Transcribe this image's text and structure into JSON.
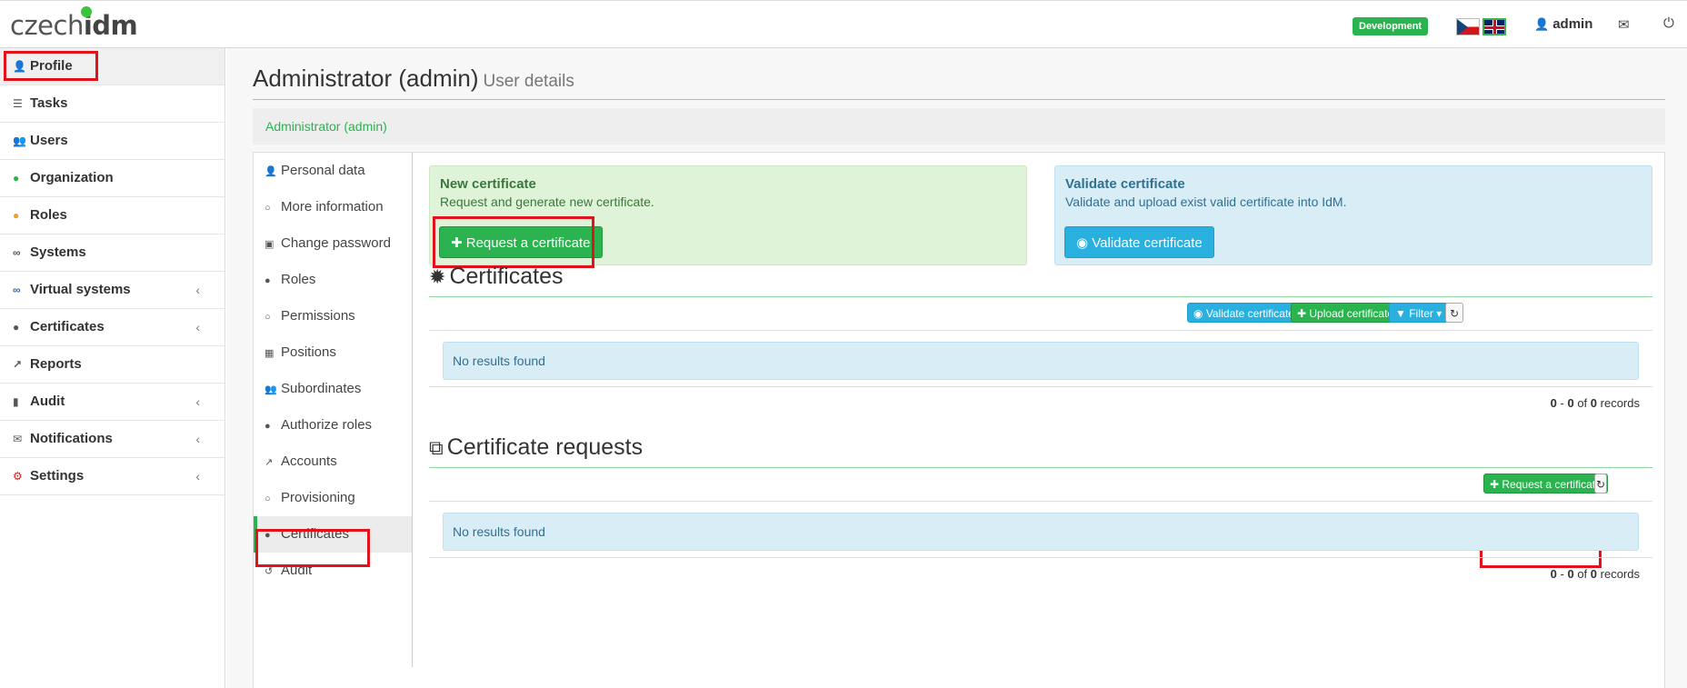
{
  "app": {
    "logo": {
      "prefix": "czech",
      "suffix": "idm"
    },
    "environment_badge": "Development",
    "user": "admin",
    "languages": [
      "cs",
      "en"
    ]
  },
  "sidebar": {
    "items": [
      {
        "label": "Profile",
        "icon": "user-icon",
        "active": true,
        "has_submenu": false
      },
      {
        "label": "Tasks",
        "icon": "tasks-icon",
        "has_submenu": false
      },
      {
        "label": "Users",
        "icon": "users-icon",
        "has_submenu": false
      },
      {
        "label": "Organization",
        "icon": "tree-icon",
        "has_submenu": false
      },
      {
        "label": "Roles",
        "icon": "role-icon",
        "has_submenu": false
      },
      {
        "label": "Systems",
        "icon": "link-icon",
        "has_submenu": false
      },
      {
        "label": "Virtual systems",
        "icon": "link-icon",
        "has_submenu": true
      },
      {
        "label": "Certificates",
        "icon": "circle-icon",
        "has_submenu": true
      },
      {
        "label": "Reports",
        "icon": "chart-icon",
        "has_submenu": false
      },
      {
        "label": "Audit",
        "icon": "bar-chart-icon",
        "has_submenu": true
      },
      {
        "label": "Notifications",
        "icon": "envelope-icon",
        "has_submenu": true
      },
      {
        "label": "Settings",
        "icon": "cog-icon",
        "has_submenu": true
      }
    ],
    "chevron": "‹"
  },
  "page": {
    "title": "Administrator (admin)",
    "subtitle": "User details",
    "breadcrumb": "Administrator (admin)"
  },
  "subnav": {
    "items": [
      {
        "label": "Personal data",
        "icon": "user-icon"
      },
      {
        "label": "More information",
        "icon": "circle-outline-icon"
      },
      {
        "label": "Change password",
        "icon": "lock-icon"
      },
      {
        "label": "Roles",
        "icon": "role-icon"
      },
      {
        "label": "Permissions",
        "icon": "circle-outline-icon"
      },
      {
        "label": "Positions",
        "icon": "building-icon"
      },
      {
        "label": "Subordinates",
        "icon": "users-icon"
      },
      {
        "label": "Authorize roles",
        "icon": "role-icon"
      },
      {
        "label": "Accounts",
        "icon": "external-link-icon"
      },
      {
        "label": "Provisioning",
        "icon": "circle-outline-icon"
      },
      {
        "label": "Certificates",
        "icon": "circle-icon",
        "active": true
      },
      {
        "label": "Audit",
        "icon": "history-icon"
      }
    ]
  },
  "new_certificate_box": {
    "title": "New certificate",
    "text": "Request and generate new certificate.",
    "button": "Request a certificate"
  },
  "validate_box": {
    "title": "Validate certificate",
    "text": "Validate and upload exist valid certificate into IdM.",
    "button": "Validate certificate"
  },
  "certificates": {
    "heading": "Certificates",
    "toolbar": {
      "validate": "Validate certificate",
      "upload": "Upload certificate",
      "filter": "Filter"
    },
    "empty": "No results found",
    "records": {
      "from": "0",
      "to": "0",
      "total": "0",
      "sep": "-",
      "of": "of",
      "label": "records"
    }
  },
  "certificate_requests": {
    "heading": "Certificate requests",
    "toolbar": {
      "request": "Request a certificate"
    },
    "empty": "No results found",
    "records": {
      "from": "0",
      "to": "0",
      "total": "0",
      "sep": "-",
      "of": "of",
      "label": "records"
    }
  },
  "colors": {
    "brand_green": "#2ab34f",
    "info_blue": "#2ab0de",
    "highlight_red": "#e0121c"
  }
}
